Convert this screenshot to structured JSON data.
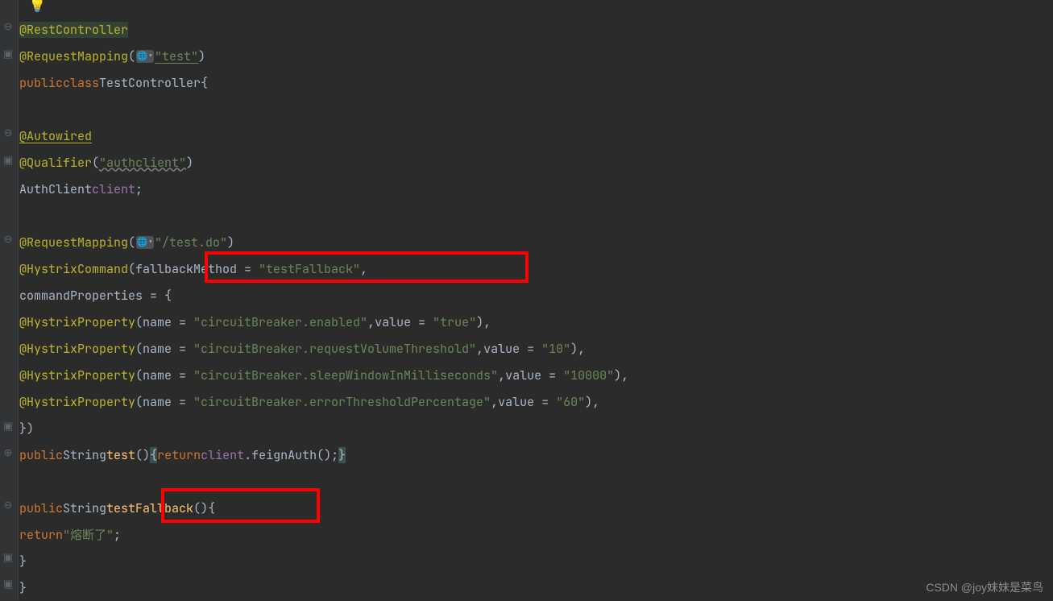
{
  "code": {
    "anno_restcontroller": "@RestController",
    "anno_requestmapping": "@RequestMapping",
    "str_test": "\"test\"",
    "kw_public": "public",
    "kw_class": "class",
    "kw_return": "return",
    "class_name": "TestController",
    "anno_autowired": "@Autowired",
    "anno_qualifier": "@Qualifier",
    "str_authclient": "\"authclient\"",
    "type_authclient": "AuthClient",
    "field_client": "client",
    "str_testdo": "\"/test.do\"",
    "anno_hystrixcommand": "@HystrixCommand",
    "param_fallback": "fallbackMethod = ",
    "str_fallback": "\"testFallback\"",
    "param_cmdprops": "commandProperties = {",
    "anno_hystrixprop": "@HystrixProperty",
    "pname": "name = ",
    "pvalue": "value = ",
    "p1name": "\"circuitBreaker.enabled\"",
    "p1val": "\"true\"",
    "p2name": "\"circuitBreaker.requestVolumeThreshold\"",
    "p2val": "\"10\"",
    "p3name": "\"circuitBreaker.sleepWindowInMilliseconds\"",
    "p3val": "\"10000\"",
    "p4name": "\"circuitBreaker.errorThresholdPercentage\"",
    "p4val": "\"60\"",
    "type_string": "String",
    "method_test": "test",
    "call_feign": "feignAuth",
    "method_fallback": "testFallback",
    "str_rongduan": "\"熔断了\""
  },
  "watermark": "CSDN @joy妹妹是菜鸟"
}
